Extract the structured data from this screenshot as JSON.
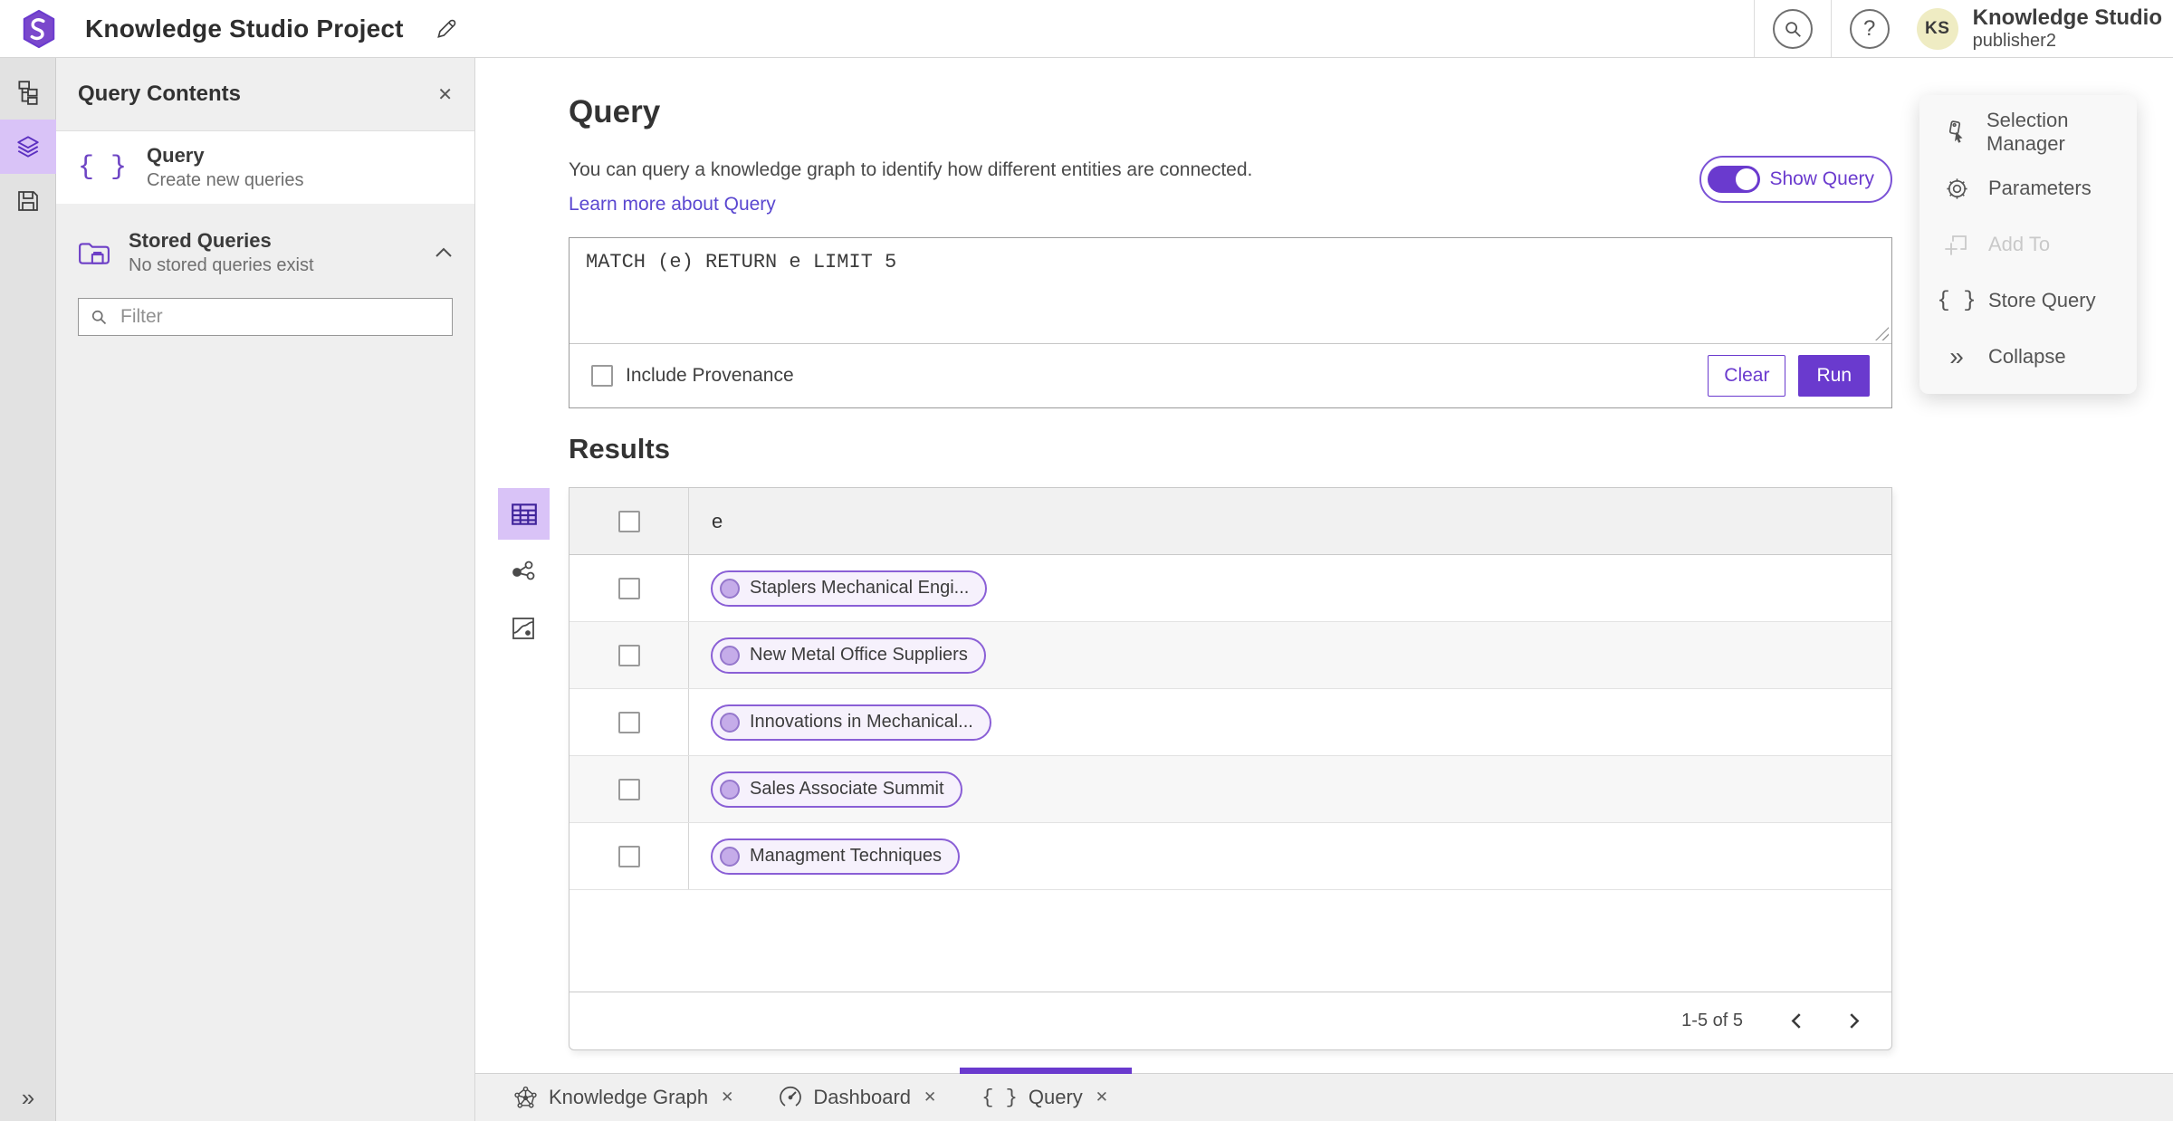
{
  "header": {
    "title": "Knowledge Studio Project",
    "avatar_initials": "KS",
    "account_name": "Knowledge Studio",
    "account_user": "publisher2"
  },
  "panel": {
    "title": "Query Contents",
    "query_item": {
      "title": "Query",
      "subtitle": "Create new queries"
    },
    "stored_item": {
      "title": "Stored Queries",
      "subtitle": "No stored queries exist"
    },
    "filter_placeholder": "Filter"
  },
  "query": {
    "heading": "Query",
    "description": "You can query a knowledge graph to identify how different entities are connected.",
    "learn_more": "Learn more about Query",
    "show_query_label": "Show Query",
    "query_text": "MATCH (e) RETURN e LIMIT 5",
    "include_provenance": "Include Provenance",
    "clear": "Clear",
    "run": "Run"
  },
  "results": {
    "heading": "Results",
    "column_header": "e",
    "rows": [
      "Staplers Mechanical Engi...",
      "New Metal Office Suppliers",
      "Innovations in Mechanical...",
      "Sales Associate Summit",
      "Managment Techniques"
    ],
    "pagination": "1-5 of 5"
  },
  "menu": {
    "items": [
      {
        "label": "Selection Manager",
        "disabled": false
      },
      {
        "label": "Parameters",
        "disabled": false
      },
      {
        "label": "Add To",
        "disabled": true
      },
      {
        "label": "Store Query",
        "disabled": false
      },
      {
        "label": "Collapse",
        "disabled": false
      }
    ]
  },
  "tabs": [
    {
      "label": "Knowledge Graph",
      "active": false
    },
    {
      "label": "Dashboard",
      "active": false
    },
    {
      "label": "Query",
      "active": true
    }
  ],
  "glyphs": {
    "close": "✕",
    "help": "?",
    "braces": "{ }",
    "collapse": "»"
  },
  "colors": {
    "accent": "#6a3ace",
    "accent_light": "#d9c3f7",
    "chip_border": "#8a5fd6",
    "chip_bg": "#f6f1fc",
    "chip_dot": "#c5ace9",
    "avatar_bg": "#efecc3",
    "link": "#5a47d0"
  }
}
